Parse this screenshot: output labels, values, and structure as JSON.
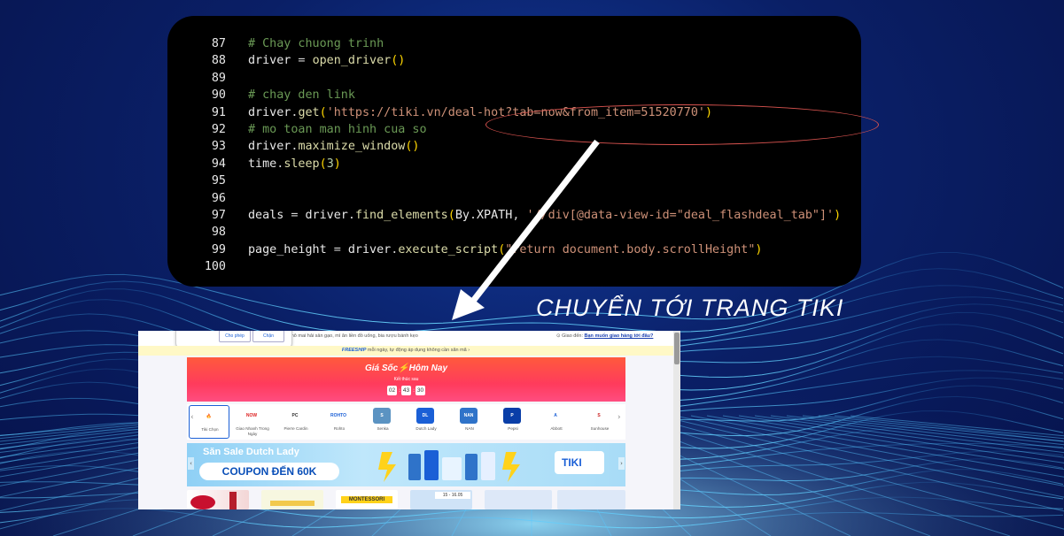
{
  "code": {
    "lines": [
      {
        "num": "87",
        "tokens": [
          {
            "t": "# Chay chuong trinh",
            "c": "cm"
          }
        ]
      },
      {
        "num": "88",
        "tokens": [
          {
            "t": "driver",
            "c": ""
          },
          {
            "t": " = ",
            "c": "op"
          },
          {
            "t": "open_driver",
            "c": "fn"
          },
          {
            "t": "()",
            "c": "pn"
          }
        ]
      },
      {
        "num": "89",
        "tokens": []
      },
      {
        "num": "90",
        "tokens": [
          {
            "t": "# chay den link",
            "c": "cm"
          }
        ]
      },
      {
        "num": "91",
        "tokens": [
          {
            "t": "driver",
            "c": ""
          },
          {
            "t": ".",
            "c": "op"
          },
          {
            "t": "get",
            "c": "fn"
          },
          {
            "t": "(",
            "c": "pn"
          },
          {
            "t": "'https://tiki.vn/deal-hot?tab=now&from_item=51520770'",
            "c": "st"
          },
          {
            "t": ")",
            "c": "pn"
          }
        ]
      },
      {
        "num": "92",
        "tokens": [
          {
            "t": "# mo toan man hinh cua so",
            "c": "cm"
          }
        ]
      },
      {
        "num": "93",
        "tokens": [
          {
            "t": "driver",
            "c": ""
          },
          {
            "t": ".",
            "c": "op"
          },
          {
            "t": "maximize_window",
            "c": "fn"
          },
          {
            "t": "()",
            "c": "pn"
          }
        ]
      },
      {
        "num": "94",
        "tokens": [
          {
            "t": "time",
            "c": ""
          },
          {
            "t": ".",
            "c": "op"
          },
          {
            "t": "sleep",
            "c": "fn"
          },
          {
            "t": "(",
            "c": "pn"
          },
          {
            "t": "3",
            "c": "nm"
          },
          {
            "t": ")",
            "c": "pn"
          }
        ]
      },
      {
        "num": "95",
        "tokens": []
      },
      {
        "num": "96",
        "tokens": []
      },
      {
        "num": "97",
        "tokens": [
          {
            "t": "deals",
            "c": ""
          },
          {
            "t": " = ",
            "c": "op"
          },
          {
            "t": "driver",
            "c": ""
          },
          {
            "t": ".",
            "c": "op"
          },
          {
            "t": "find_elements",
            "c": "fn"
          },
          {
            "t": "(",
            "c": "pn"
          },
          {
            "t": "By",
            "c": ""
          },
          {
            "t": ".",
            "c": "op"
          },
          {
            "t": "XPATH",
            "c": ""
          },
          {
            "t": ", ",
            "c": "op"
          },
          {
            "t": "'//div[@data-view-id=\"deal_flashdeal_tab\"]'",
            "c": "st"
          },
          {
            "t": ")",
            "c": "pn"
          }
        ]
      },
      {
        "num": "98",
        "tokens": []
      },
      {
        "num": "99",
        "tokens": [
          {
            "t": "page_height",
            "c": ""
          },
          {
            "t": " = ",
            "c": "op"
          },
          {
            "t": "driver",
            "c": ""
          },
          {
            "t": ".",
            "c": "op"
          },
          {
            "t": "execute_script",
            "c": "fn"
          },
          {
            "t": "(",
            "c": "pn"
          },
          {
            "t": "\"return document.body.scrollHeight\"",
            "c": "st"
          },
          {
            "t": ")",
            "c": "pn"
          }
        ]
      },
      {
        "num": "100",
        "tokens": []
      }
    ]
  },
  "caption": "CHUYỂN TỚI TRANG TIKI",
  "screenshot": {
    "popup": {
      "allow": "Cho phép",
      "block": "Chặn"
    },
    "top_categories": "thịt, rau củ   nhà cửa   điện gia dụng   thiết bị số   điện thoại   mẹ & bé   làm đẹp   gia dụng   thực phẩm   sữa   khô mai   hải sản   gạo, mì ăn liền   đồ uống, bia rượu   bánh kẹo",
    "top_categories_visible": "khô mai   hải sản   gạo, mì ăn liền   đồ uống, bia rượu   bánh kẹo",
    "delivery_label": "Giao đến:",
    "delivery_link": "Bạn muốn giao hàng tới đâu?",
    "freeship_label": "FREESHIP",
    "freeship_text": "mỗi ngày, tự động áp dụng không cần săn mã",
    "hero": {
      "title": "Giá Sốc⚡Hôm Nay",
      "ends_label": "Kết thúc sau",
      "timer": [
        "02",
        "43",
        "30"
      ]
    },
    "brands": [
      {
        "name": "Tiki Chọn",
        "logo": "🔥",
        "color": "#ffffff",
        "text_color": "#e33"
      },
      {
        "name": "Giao Nhanh Trong Ngày",
        "logo": "NOW",
        "color": "#ffffff",
        "text_color": "#d22"
      },
      {
        "name": "Pierre Cardin",
        "logo": "PC",
        "color": "#ffffff",
        "text_color": "#333"
      },
      {
        "name": "Rohto",
        "logo": "ROHTO",
        "color": "#ffffff",
        "text_color": "#1a5fd6"
      },
      {
        "name": "Senka",
        "logo": "S",
        "color": "#5b93c2",
        "text_color": "#ffffff"
      },
      {
        "name": "Dutch Lady",
        "logo": "DL",
        "color": "#1a5fd6",
        "text_color": "#ffffff"
      },
      {
        "name": "NAN",
        "logo": "NAN",
        "color": "#2f73c9",
        "text_color": "#ffffff"
      },
      {
        "name": "Pepsi",
        "logo": "P",
        "color": "#0a3ea8",
        "text_color": "#ffffff"
      },
      {
        "name": "Abbott",
        "logo": "A",
        "color": "#ffffff",
        "text_color": "#1a5fd6"
      },
      {
        "name": "Sunhouse",
        "logo": "S",
        "color": "#ffffff",
        "text_color": "#c22"
      }
    ],
    "banner": {
      "headline": "Săn Sale Dutch Lady",
      "coupon": "COUPON ĐẾN 60K",
      "logo": "TIKI"
    },
    "bottom_tiles_text": "MONTESSORI",
    "bottom_tile_date": "15 - 16.05"
  }
}
